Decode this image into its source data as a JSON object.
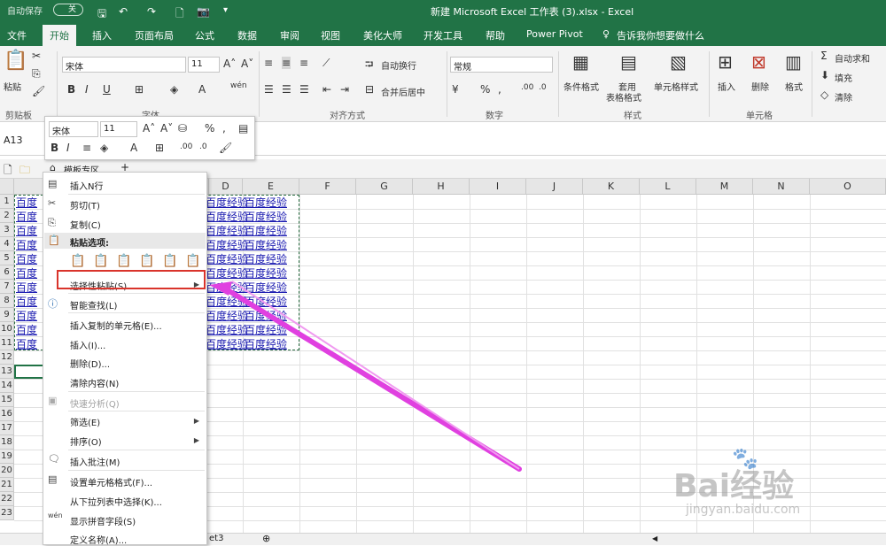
{
  "titlebar": {
    "autosave": "自动保存",
    "autosave_state": "关",
    "title": "新建 Microsoft Excel 工作表 (3).xlsx  -  Excel"
  },
  "tabs": [
    "文件",
    "开始",
    "插入",
    "页面布局",
    "公式",
    "数据",
    "审阅",
    "视图",
    "美化大师",
    "开发工具",
    "帮助",
    "Power Pivot"
  ],
  "tellme": "告诉我你想要做什么",
  "ribbon": {
    "paste": "粘贴",
    "font_name": "宋体",
    "font_size": "11",
    "wrap": "自动换行",
    "merge": "合并后居中",
    "number_format": "常规",
    "conditional": "条件格式",
    "table_fmt_1": "套用",
    "table_fmt_2": "表格格式",
    "cell_style": "单元格样式",
    "insert": "插入",
    "delete": "删除",
    "format": "格式",
    "autosum": "自动求和",
    "fill": "填充",
    "clear": "清除",
    "groups": {
      "clipboard": "剪贴板",
      "font": "字体",
      "alignment": "对齐方式",
      "number": "数字",
      "styles": "样式",
      "cells": "单元格"
    }
  },
  "namebox": "A13",
  "minitoolbar": {
    "font": "宋体",
    "size": "11"
  },
  "sheet_tab": "模板专区",
  "sheet_name_tail": "et3",
  "columns": [
    "D",
    "E",
    "F",
    "G",
    "H",
    "I",
    "J",
    "K",
    "L",
    "M",
    "N",
    "O"
  ],
  "rows": [
    "1",
    "2",
    "3",
    "4",
    "5",
    "6",
    "7",
    "8",
    "9",
    "10",
    "11",
    "12",
    "13",
    "14",
    "15",
    "16",
    "17",
    "18",
    "19",
    "20",
    "21",
    "22",
    "23"
  ],
  "cell_text": "百度经验",
  "cell_text_left": "百度",
  "context_menu": {
    "insert_n_rows": "插入N行",
    "cut": "剪切(T)",
    "copy": "复制(C)",
    "paste_options": "粘贴选项:",
    "paste_special": "选择性粘贴(S)...",
    "smart_lookup": "智能查找(L)",
    "insert_copied": "插入复制的单元格(E)...",
    "insert": "插入(I)...",
    "delete": "删除(D)...",
    "clear": "清除内容(N)",
    "quick_analysis": "快速分析(Q)",
    "filter": "筛选(E)",
    "sort": "排序(O)",
    "insert_comment": "插入批注(M)",
    "format_cells": "设置单元格格式(F)...",
    "pick_list": "从下拉列表中选择(K)...",
    "phonetic": "显示拼音字段(S)",
    "define_name": "定义名称(A)..."
  },
  "watermark": {
    "brand": "Bai经验",
    "url": "jingyan.baidu.com"
  },
  "colors": {
    "excel_green": "#217346",
    "arrow": "#e040e0",
    "highlight_box": "#d9342b"
  }
}
